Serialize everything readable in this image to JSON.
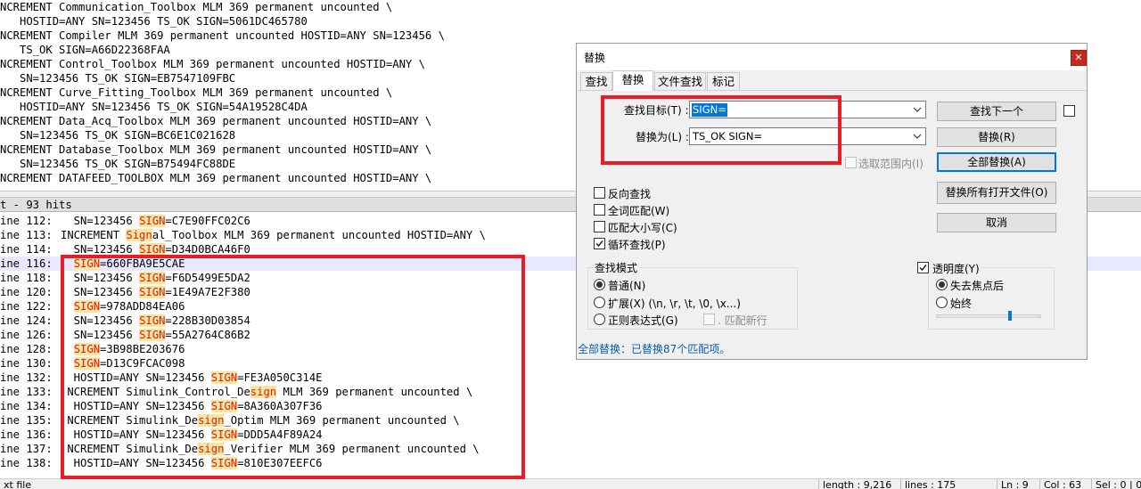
{
  "editor": {
    "lines": [
      "NCREMENT Communication_Toolbox MLM 369 permanent uncounted \\",
      "   HOSTID=ANY SN=123456 TS_OK SIGN=5061DC465780",
      "NCREMENT Compiler MLM 369 permanent uncounted HOSTID=ANY SN=123456 \\",
      "   TS_OK SIGN=A66D22368FAA",
      "NCREMENT Control_Toolbox MLM 369 permanent uncounted HOSTID=ANY \\",
      "   SN=123456 TS_OK SIGN=EB7547109FBC",
      "NCREMENT Curve_Fitting_Toolbox MLM 369 permanent uncounted \\",
      "   HOSTID=ANY SN=123456 TS_OK SIGN=54A19528C4DA",
      "NCREMENT Data_Acq_Toolbox MLM 369 permanent uncounted HOSTID=ANY \\",
      "   SN=123456 TS_OK SIGN=BC6E1C021628",
      "NCREMENT Database_Toolbox MLM 369 permanent uncounted HOSTID=ANY \\",
      "   SN=123456 TS_OK SIGN=B75494FC88DE",
      "NCREMENT DATAFEED_TOOLBOX MLM 369 permanent uncounted HOSTID=ANY \\"
    ]
  },
  "results": {
    "header": "t - 93 hits",
    "rows": [
      {
        "num": "ine 112:",
        "parts": [
          [
            "  SN=123456 ",
            false
          ],
          [
            "SIGN",
            true
          ],
          [
            "=C7E90FFC02C6",
            false
          ]
        ]
      },
      {
        "num": "ine 113:",
        "parts": [
          [
            "INCREMENT ",
            false
          ],
          [
            "Sign",
            true
          ],
          [
            "al_Toolbox MLM 369 permanent uncounted HOSTID=ANY \\",
            false
          ]
        ]
      },
      {
        "num": "ine 114:",
        "parts": [
          [
            "  SN=123456 ",
            false
          ],
          [
            "SIGN",
            true
          ],
          [
            "=D34D0BCA46F0",
            false
          ]
        ]
      },
      {
        "num": "ine 116:",
        "parts": [
          [
            "  ",
            false
          ],
          [
            "SIGN",
            true
          ],
          [
            "=660FBA9E5CAE",
            false
          ]
        ]
      },
      {
        "num": "ine 118:",
        "parts": [
          [
            "  SN=123456 ",
            false
          ],
          [
            "SIGN",
            true
          ],
          [
            "=F6D5499E5DA2",
            false
          ]
        ]
      },
      {
        "num": "ine 120:",
        "parts": [
          [
            "  SN=123456 ",
            false
          ],
          [
            "SIGN",
            true
          ],
          [
            "=1E49A7E2F380",
            false
          ]
        ]
      },
      {
        "num": "ine 122:",
        "parts": [
          [
            "  ",
            false
          ],
          [
            "SIGN",
            true
          ],
          [
            "=978ADD84EA06",
            false
          ]
        ]
      },
      {
        "num": "ine 124:",
        "parts": [
          [
            "  SN=123456 ",
            false
          ],
          [
            "SIGN",
            true
          ],
          [
            "=228B30D03854",
            false
          ]
        ]
      },
      {
        "num": "ine 126:",
        "parts": [
          [
            "  SN=123456 ",
            false
          ],
          [
            "SIGN",
            true
          ],
          [
            "=55A2764C86B2",
            false
          ]
        ]
      },
      {
        "num": "ine 128:",
        "parts": [
          [
            "  ",
            false
          ],
          [
            "SIGN",
            true
          ],
          [
            "=3B98BE203676",
            false
          ]
        ]
      },
      {
        "num": "ine 130:",
        "parts": [
          [
            "  ",
            false
          ],
          [
            "SIGN",
            true
          ],
          [
            "=D13C9FCAC098",
            false
          ]
        ]
      },
      {
        "num": "ine 132:",
        "parts": [
          [
            "  HOSTID=ANY SN=123456 ",
            false
          ],
          [
            "SIGN",
            true
          ],
          [
            "=FE3A050C314E",
            false
          ]
        ]
      },
      {
        "num": "ine 133:",
        "parts": [
          [
            " NCREMENT Simulink_Control_De",
            false
          ],
          [
            "sign",
            true
          ],
          [
            " MLM 369 permanent uncounted \\",
            false
          ]
        ]
      },
      {
        "num": "ine 134:",
        "parts": [
          [
            "  HOSTID=ANY SN=123456 ",
            false
          ],
          [
            "SIGN",
            true
          ],
          [
            "=8A360A307F36",
            false
          ]
        ]
      },
      {
        "num": "ine 135:",
        "parts": [
          [
            " NCREMENT Simulink_De",
            false
          ],
          [
            "sign",
            true
          ],
          [
            "_Optim MLM 369 permanent uncounted \\",
            false
          ]
        ]
      },
      {
        "num": "ine 136:",
        "parts": [
          [
            "  HOSTID=ANY SN=123456 ",
            false
          ],
          [
            "SIGN",
            true
          ],
          [
            "=DDD5A4F89A24",
            false
          ]
        ]
      },
      {
        "num": "ine 137:",
        "parts": [
          [
            " NCREMENT Simulink_De",
            false
          ],
          [
            "sign",
            true
          ],
          [
            "_Verifier MLM 369 permanent uncounted \\",
            false
          ]
        ]
      },
      {
        "num": "ine 138:",
        "parts": [
          [
            "  HOSTID=ANY SN=123456 ",
            false
          ],
          [
            "SIGN",
            true
          ],
          [
            "=810E307EEFC6",
            false
          ]
        ]
      }
    ]
  },
  "statusbar": {
    "file_type": "xt file",
    "length": "length : 9,216",
    "lines": "lines : 175",
    "ln": "Ln : 9",
    "col": "Col : 63",
    "sel": "Sel : 0 | 0"
  },
  "dialog": {
    "title": "替换",
    "close_icon": "close-icon",
    "tabs": [
      "查找",
      "替换",
      "文件查找",
      "标记"
    ],
    "active_tab": 1,
    "find_label": "查找目标(T) :",
    "find_value": "SIGN=",
    "replace_label": "替换为(L) :",
    "replace_value": "TS_OK SIGN=",
    "in_selection": "选取范围内(I)",
    "buttons": {
      "find_next": "查找下一个",
      "replace": "替换(R)",
      "replace_all": "全部替换(A)",
      "replace_all_open": "替换所有打开文件(O)",
      "cancel": "取消"
    },
    "options": [
      {
        "label": "反向查找",
        "checked": false
      },
      {
        "label": "全词匹配(W)",
        "checked": false
      },
      {
        "label": "匹配大小写(C)",
        "checked": false
      },
      {
        "label": "循环查找(P)",
        "checked": true
      }
    ],
    "search_mode": {
      "title": "查找模式",
      "normal": "普通(N)",
      "extended": "扩展(X) (\\n, \\r, \\t, \\0, \\x...)",
      "regex": "正则表达式(G)",
      "dot_newline": ". 匹配新行",
      "selected": "normal"
    },
    "transparency": {
      "label": "透明度(Y)",
      "checked": true,
      "on_lose_focus": "失去焦点后",
      "always": "始终",
      "selected": "on_lose_focus",
      "level": 0.7
    },
    "status": "全部替换：已替换87个匹配项。"
  },
  "colors": {
    "annotation_red": "#ed1c24",
    "match_highlight_bg": "#fbe49b",
    "match_text": "#e81818",
    "selection_blue": "#0078d7",
    "status_blue": "#0b5cad"
  }
}
